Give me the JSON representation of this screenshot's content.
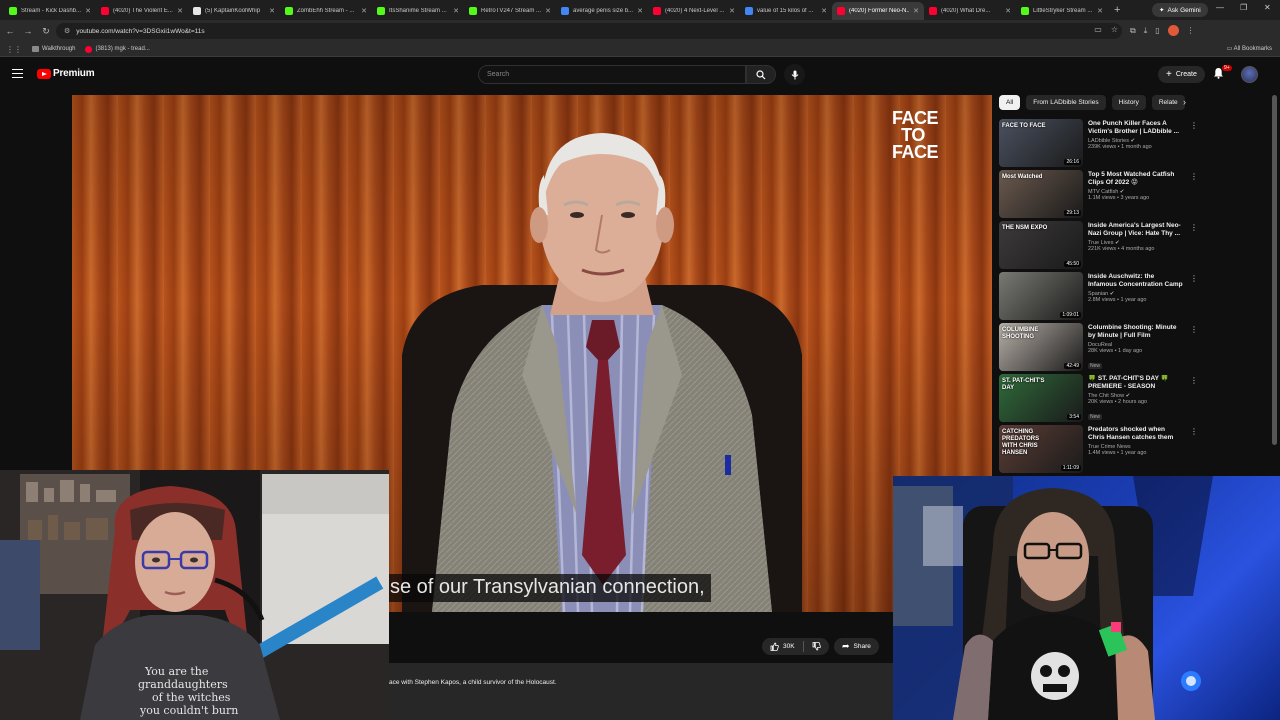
{
  "browser": {
    "tabs": [
      {
        "label": "Stream - Kick Dashb...",
        "color": "#53fc18"
      },
      {
        "label": "(4020) The Violent E...",
        "color": "#ff0033"
      },
      {
        "label": "(5) KaptainKoolWhip",
        "color": "#e7e7e7"
      },
      {
        "label": "ZombEhh Stream - ...",
        "color": "#53fc18"
      },
      {
        "label": "ItsShanime Stream ...",
        "color": "#53fc18"
      },
      {
        "label": "RetroTV247 Stream ...",
        "color": "#53fc18"
      },
      {
        "label": "average penis size b...",
        "color": "#4285f4"
      },
      {
        "label": "(4020) 4 Next-Level ...",
        "color": "#ff0033"
      },
      {
        "label": "value of 15 kilos of ...",
        "color": "#4285f4"
      },
      {
        "label": "(4020) Former Neo-N...",
        "color": "#ff0033",
        "active": true
      },
      {
        "label": "(4020) What Dre...",
        "color": "#ff0033"
      },
      {
        "label": "LittleStryker Stream ...",
        "color": "#53fc18"
      }
    ],
    "gemini_label": "Ask Gemini",
    "url": "youtube.com/watch?v=3DSGxii1wWo&t=11s",
    "bookmarks": [
      {
        "label": "Walkthrough",
        "icon": "folder-icon"
      },
      {
        "label": "(3813) mgk - tread...",
        "icon": "youtube-icon"
      }
    ],
    "all_bookmarks": "All Bookmarks"
  },
  "youtube": {
    "logo_text": "Premium",
    "search_placeholder": "Search",
    "create_label": "Create",
    "notification_badge": "9+",
    "player": {
      "overlay_logo_line1": "FACE",
      "overlay_logo_line2": "TO",
      "overlay_logo_line3": "FACE",
      "caption": "se of our Transylvanian connection,"
    },
    "actions": {
      "like_count": "30K",
      "share_label": "Share"
    },
    "description": "ace with Stephen Kapos, a child survivor of the Holocaust.",
    "chips": [
      "All",
      "From LADbible Stories",
      "History",
      "Relate"
    ],
    "recommendations": [
      {
        "title": "One Punch Killer Faces A Victim's Brother | LADbible ...",
        "channel": "LADbible Stories",
        "meta": "239K views • 1 month ago",
        "duration": "26:16",
        "thumb_text": "FACE TO FACE",
        "bg": "#4a5160",
        "verified": true
      },
      {
        "title": "Top 5 Most Watched Catfish Clips Of 2022 😝",
        "channel": "MTV Catfish",
        "meta": "1.1M views • 3 years ago",
        "duration": "29:13",
        "thumb_text": "Most Watched",
        "bg": "#6b5a4e",
        "verified": true
      },
      {
        "title": "Inside America's Largest Neo-Nazi Group | Vice: Hate Thy ...",
        "channel": "True Lives",
        "meta": "221K views • 4 months ago",
        "duration": "45:50",
        "thumb_text": "THE NSM EXPO",
        "bg": "#3d3a3a",
        "verified": true
      },
      {
        "title": "Inside Auschwitz: the Infamous Concentration Camp",
        "channel": "Spanian",
        "meta": "2.8M views • 1 year ago",
        "duration": "1:09:01",
        "thumb_text": "",
        "bg": "#7a7a74",
        "verified": true
      },
      {
        "title": "Columbine Shooting: Minute by Minute | Full Film",
        "channel": "DocuReal",
        "meta": "28K views • 1 day ago",
        "duration": "42:49",
        "thumb_text": "COLUMBINE SHOOTING",
        "bg": "#b8b0a8",
        "verified": false,
        "new": "New"
      },
      {
        "title": "🍀 ST. PAT-CHIT'S DAY 🍀 PREMIERE - SEASON RETURN",
        "channel": "The Chit Show",
        "meta": "20K views • 2 hours ago",
        "duration": "3:54",
        "thumb_text": "ST. PAT-CHIT'S DAY",
        "bg": "#2f6b3a",
        "verified": true,
        "new": "New"
      },
      {
        "title": "Predators shocked when Chris Hansen catches them red-...",
        "channel": "True Crime News",
        "meta": "1.4M views • 1 year ago",
        "duration": "1:11:09",
        "thumb_text": "CATCHING PREDATORS WITH CHRIS HANSEN",
        "bg": "#5c3e36",
        "verified": false
      }
    ]
  },
  "webcams": {
    "left_shirt_text": "You are the granddaughters of the witches you couldn't burn"
  },
  "colors": {
    "accent": "#ff0000",
    "kick_green": "#53fc18",
    "background": "#0f0f0f"
  }
}
